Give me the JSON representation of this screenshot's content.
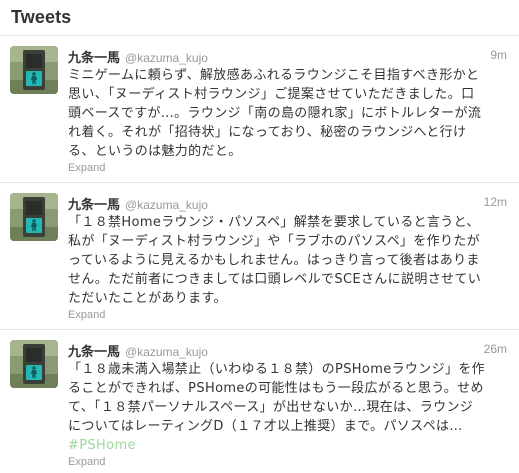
{
  "header": {
    "title": "Tweets"
  },
  "tweets": [
    {
      "fullname": "九条一馬",
      "username": "@kazuma_kujo",
      "time": "9m",
      "text": "ミニゲームに頼らず、解放感あふれるラウンジこそ目指すべき形かと\n思い、「ヌーディスト村ラウンジ」ご提案させていただきました。口\n頭ベースですが…。ラウンジ「南の島の隠れ家」にボトルレターが流\nれ着く。それが「招待状」になっており、秘密のラウンジへと行け\nる、というのは魅力的だと。",
      "hashtag": "",
      "expand": "Expand"
    },
    {
      "fullname": "九条一馬",
      "username": "@kazuma_kujo",
      "time": "12m",
      "text": "「１８禁Homeラウンジ・パソスペ」解禁を要求していると言うと、\n私が「ヌーディスト村ラウンジ」や「ラブホのパソスペ」を作りたが\nっているように見えるかもしれません。はっきり言って後者はありま\nせん。ただ前者につきましては口頭レベルでSCEさんに説明させてい\nただいたことがあります。",
      "hashtag": "",
      "expand": "Expand"
    },
    {
      "fullname": "九条一馬",
      "username": "@kazuma_kujo",
      "time": "26m",
      "text": "「１８歳未満入場禁止（いわゆる１８禁）のPSHomeラウンジ」を作\nることができれば、PSHomeの可能性はもう一段広がると思う。せめ\nて、「１８禁パーソナルスペース」が出せないか…現在は、ラウンジ\nについてはレーティングD（１７才以上推奨）まで。パソスペは…",
      "hashtag": "#PSHome",
      "expand": "Expand"
    }
  ]
}
